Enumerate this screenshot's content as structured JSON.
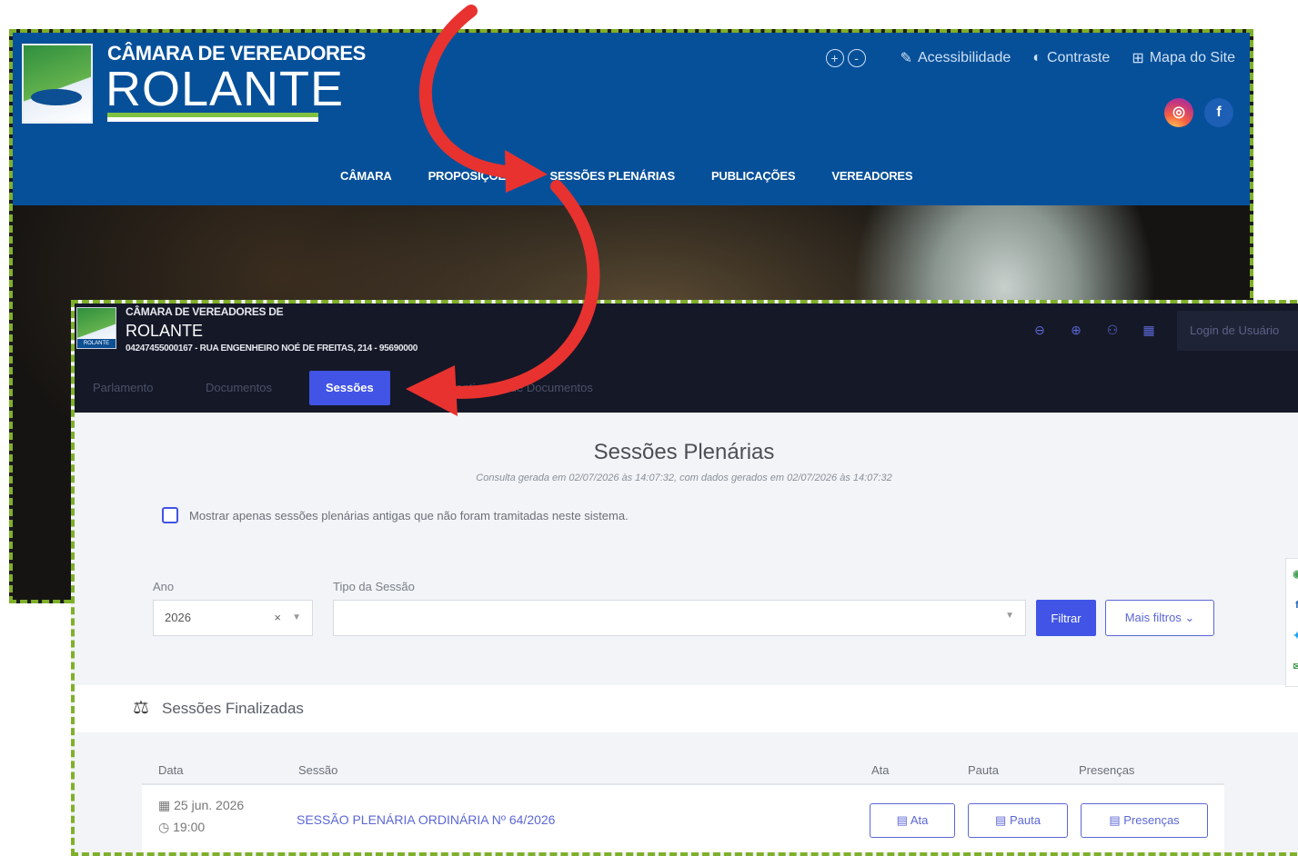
{
  "back_site": {
    "logo": {
      "line1": "CÂMARA DE VEREADORES",
      "line2": "ROLANTE"
    },
    "tools": {
      "zoom_in": "+",
      "zoom_out": "-",
      "acessibilidade": "Acessibilidade",
      "contraste": "Contraste",
      "mapa": "Mapa do Site"
    },
    "social": {
      "instagram": "◎",
      "facebook": "f"
    },
    "menu": [
      "CÂMARA",
      "PROPOSIÇÕES",
      "SESSÕES PLENÁRIAS",
      "PUBLICAÇÕES",
      "VEREADORES"
    ]
  },
  "front_site": {
    "header": {
      "title_small": "CÂMARA DE VEREADORES DE",
      "title_big": "ROLANTE",
      "address": "04247455000167 - RUA ENGENHEIRO NOÉ DE FREITAS, 214 - 95690000",
      "logo_caption": "ROLANTE",
      "login": "Login de Usuário"
    },
    "tabs": [
      "Parlamento",
      "Documentos",
      "Sessões",
      "Autenticação de Documentos"
    ],
    "page": {
      "title": "Sessões Plenárias",
      "subtitle": "Consulta gerada em 02/07/2026 às 14:07:32, com dados gerados em 02/07/2026 às 14:07:32",
      "checkbox_label": "Mostrar apenas sessões plenárias antigas que não foram tramitadas neste sistema."
    },
    "filters": {
      "ano_label": "Ano",
      "ano_value": "2026",
      "ano_clear": "×",
      "tipo_label": "Tipo da Sessão",
      "filtrar": "Filtrar",
      "mais_filtros": "Mais filtros ⌄"
    },
    "finalizadas": {
      "title": "Sessões Finalizadas",
      "columns": [
        "Data",
        "Sessão",
        "Ata",
        "Pauta",
        "Presenças"
      ],
      "rows": [
        {
          "date": "25 jun. 2026",
          "time": "19:00",
          "sessao": "SESSÃO PLENÁRIA ORDINÁRIA Nº 64/2026",
          "ata": "Ata",
          "pauta": "Pauta",
          "presencas": "Presenças"
        }
      ]
    }
  },
  "colors": {
    "back_header": "#06509a",
    "front_header": "#151827",
    "accent": "#4154e6",
    "frame": "#7fb02a",
    "arrow": "#e8322f"
  }
}
